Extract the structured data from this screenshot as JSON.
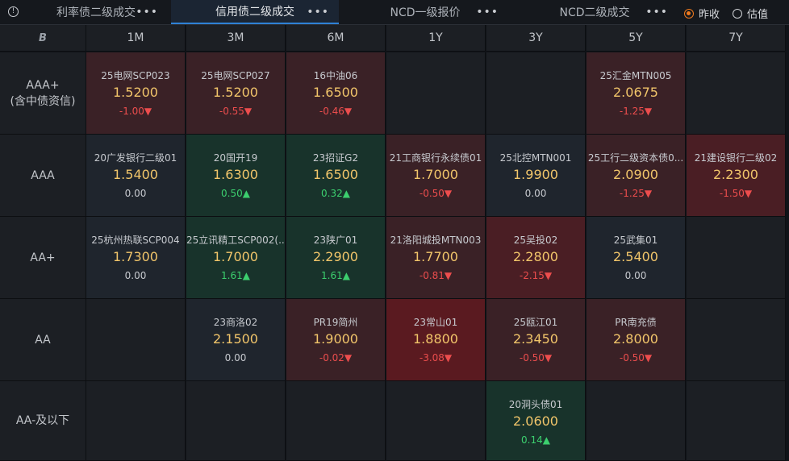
{
  "tabs": [
    {
      "label": "利率债二级成交",
      "more": "•••"
    },
    {
      "label": "信用债二级成交",
      "more": "•••",
      "active": true
    },
    {
      "label": "NCD一级报价",
      "more": "•••"
    },
    {
      "label": "NCD二级成交",
      "more": "•••"
    }
  ],
  "radios": [
    {
      "label": "昨收",
      "checked": true
    },
    {
      "label": "估值",
      "checked": false
    }
  ],
  "corner_icon": "B",
  "columns": [
    "1M",
    "3M",
    "6M",
    "1Y",
    "3Y",
    "5Y",
    "7Y"
  ],
  "rows": [
    {
      "label": "AAA+\n(含中债资信)",
      "cells": [
        {
          "name": "25电网SCP023",
          "price": "1.5200",
          "change": "-1.00▼",
          "tone": "red",
          "dir": "down"
        },
        {
          "name": "25电网SCP027",
          "price": "1.5200",
          "change": "-0.55▼",
          "tone": "red",
          "dir": "down"
        },
        {
          "name": "16中油06",
          "price": "1.6500",
          "change": "-0.46▼",
          "tone": "red",
          "dir": "down"
        },
        null,
        null,
        {
          "name": "25汇金MTN005",
          "price": "2.0675",
          "change": "-1.25▼",
          "tone": "red",
          "dir": "down"
        },
        null
      ]
    },
    {
      "label": "AAA",
      "cells": [
        {
          "name": "20广发银行二级01",
          "price": "1.5400",
          "change": "0.00",
          "tone": "neutral",
          "dir": "flat"
        },
        {
          "name": "20国开19",
          "price": "1.6300",
          "change": "0.50▲",
          "tone": "green",
          "dir": "up"
        },
        {
          "name": "23招证G2",
          "price": "1.6500",
          "change": "0.32▲",
          "tone": "green",
          "dir": "up"
        },
        {
          "name": "21工商银行永续债01",
          "price": "1.7000",
          "change": "-0.50▼",
          "tone": "red",
          "dir": "down"
        },
        {
          "name": "25北控MTN001",
          "price": "1.9900",
          "change": "0.00",
          "tone": "neutral",
          "dir": "flat"
        },
        {
          "name": "25工行二级资本债0...",
          "price": "2.0900",
          "change": "-1.25▼",
          "tone": "red",
          "dir": "down"
        },
        {
          "name": "21建设银行二级02",
          "price": "2.2300",
          "change": "-1.50▼",
          "tone": "red2",
          "dir": "down"
        }
      ]
    },
    {
      "label": "AA+",
      "cells": [
        {
          "name": "25杭州热联SCP004",
          "price": "1.7300",
          "change": "0.00",
          "tone": "neutral",
          "dir": "flat"
        },
        {
          "name": "25立讯精工SCP002(...",
          "price": "1.7000",
          "change": "1.61▲",
          "tone": "green",
          "dir": "up"
        },
        {
          "name": "23陕广01",
          "price": "2.2900",
          "change": "1.61▲",
          "tone": "green",
          "dir": "up"
        },
        {
          "name": "21洛阳城投MTN003",
          "price": "1.7700",
          "change": "-0.81▼",
          "tone": "red",
          "dir": "down"
        },
        {
          "name": "25吴投02",
          "price": "2.2800",
          "change": "-2.15▼",
          "tone": "red2",
          "dir": "down"
        },
        {
          "name": "25武集01",
          "price": "2.5400",
          "change": "0.00",
          "tone": "neutral",
          "dir": "flat"
        },
        null
      ]
    },
    {
      "label": "AA",
      "cells": [
        null,
        {
          "name": "23商洛02",
          "price": "2.1500",
          "change": "0.00",
          "tone": "neutral",
          "dir": "flat"
        },
        {
          "name": "PR19简州",
          "price": "1.9000",
          "change": "-0.02▼",
          "tone": "red",
          "dir": "down"
        },
        {
          "name": "23常山01",
          "price": "1.8800",
          "change": "-3.08▼",
          "tone": "red3",
          "dir": "down"
        },
        {
          "name": "25瓯江01",
          "price": "2.3450",
          "change": "-0.50▼",
          "tone": "red",
          "dir": "down"
        },
        {
          "name": "PR南充债",
          "price": "2.8000",
          "change": "-0.50▼",
          "tone": "red",
          "dir": "down"
        },
        null
      ]
    },
    {
      "label": "AA-及以下",
      "cells": [
        null,
        null,
        null,
        null,
        {
          "name": "20洞头债01",
          "price": "2.0600",
          "change": "0.14▲",
          "tone": "green",
          "dir": "up"
        },
        null,
        null
      ]
    }
  ]
}
